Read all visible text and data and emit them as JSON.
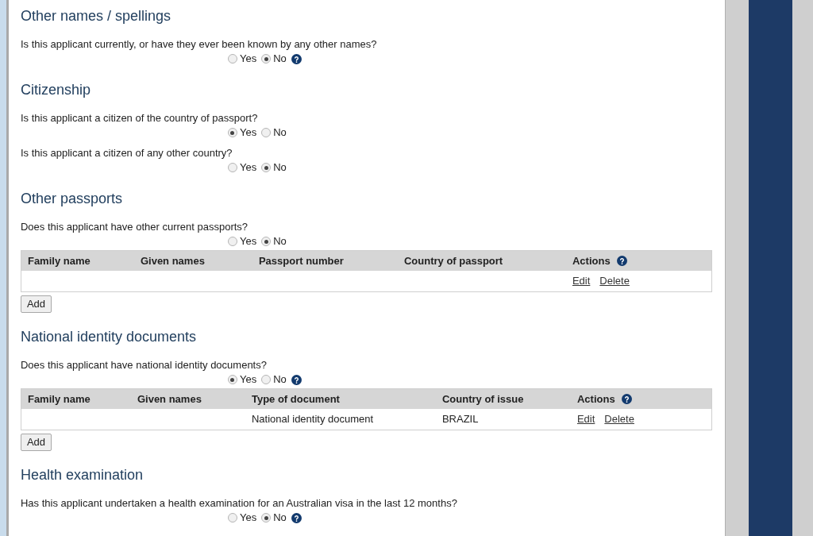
{
  "sections": [
    {
      "title": "Other names / spellings",
      "questions": [
        {
          "text": "Is this applicant currently, or have they ever been known by any other names?",
          "help": true,
          "options": [
            {
              "label": "Yes",
              "selected": false
            },
            {
              "label": "No",
              "selected": true
            }
          ]
        }
      ]
    },
    {
      "title": "Citizenship",
      "questions": [
        {
          "text": "Is this applicant a citizen of the country of passport?",
          "help": false,
          "options": [
            {
              "label": "Yes",
              "selected": true
            },
            {
              "label": "No",
              "selected": false
            }
          ]
        },
        {
          "text": "Is this applicant a citizen of any other country?",
          "help": false,
          "options": [
            {
              "label": "Yes",
              "selected": false
            },
            {
              "label": "No",
              "selected": true
            }
          ]
        }
      ]
    },
    {
      "title": "Other passports",
      "questions": [
        {
          "text": "Does this applicant have other current passports?",
          "help": false,
          "options": [
            {
              "label": "Yes",
              "selected": false
            },
            {
              "label": "No",
              "selected": true
            }
          ]
        }
      ],
      "table": {
        "columns": [
          {
            "label": "Family name",
            "help": false
          },
          {
            "label": "Given names",
            "help": false
          },
          {
            "label": "Passport number",
            "help": false
          },
          {
            "label": "Country of passport",
            "help": false
          },
          {
            "label": "Actions",
            "help": true
          }
        ],
        "rows": [
          {
            "cells": [
              null,
              null,
              null,
              null
            ],
            "actions": [
              "Edit",
              "Delete"
            ]
          }
        ]
      },
      "add_button": "Add"
    },
    {
      "title": "National identity documents",
      "questions": [
        {
          "text": "Does this applicant have national identity documents?",
          "help": true,
          "options": [
            {
              "label": "Yes",
              "selected": true
            },
            {
              "label": "No",
              "selected": false
            }
          ]
        }
      ],
      "table": {
        "columns": [
          {
            "label": "Family name",
            "help": false
          },
          {
            "label": "Given names",
            "help": false
          },
          {
            "label": "Type of document",
            "help": false
          },
          {
            "label": "Country of issue",
            "help": false
          },
          {
            "label": "Actions",
            "help": true
          }
        ],
        "rows": [
          {
            "cells": [
              null,
              null,
              "National identity document",
              "BRAZIL"
            ],
            "actions": [
              "Edit",
              "Delete"
            ]
          }
        ]
      },
      "add_button": "Add"
    },
    {
      "title": "Health examination",
      "questions": [
        {
          "text": "Has this applicant undertaken a health examination for an Australian visa in the last 12 months?",
          "help": true,
          "options": [
            {
              "label": "Yes",
              "selected": false
            },
            {
              "label": "No",
              "selected": true
            }
          ]
        }
      ]
    }
  ]
}
